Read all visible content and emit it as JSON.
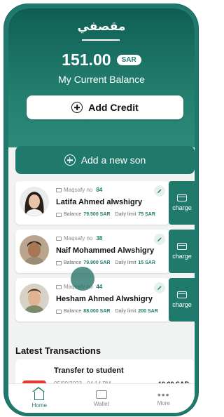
{
  "header": {
    "brand": "مقصفي",
    "balance": "151.00",
    "currency": "SAR",
    "balance_label": "My Current Balance",
    "add_credit_label": "Add Credit"
  },
  "add_son_label": "Add a new son",
  "sons": [
    {
      "maqsafy_label": "Maqsafy no",
      "maqsafy_no": "84",
      "name": "Latifa Ahmed alwshigry",
      "balance_label": "Balance",
      "balance": "79.500 SAR",
      "limit_label": "Daily limit",
      "limit": "75 SAR",
      "charge_label": "charge"
    },
    {
      "maqsafy_label": "Maqsafy no",
      "maqsafy_no": "38",
      "name": "Naif Mohammed Alwshigry",
      "balance_label": "Balance",
      "balance": "79.900 SAR",
      "limit_label": "Daily limit",
      "limit": "15 SAR",
      "charge_label": "charge"
    },
    {
      "maqsafy_label": "Maqsafy no",
      "maqsafy_no": "44",
      "name": "Hesham Ahmed Alwshigry",
      "balance_label": "Balance",
      "balance": "88.000 SAR",
      "limit_label": "Daily limit",
      "limit": "200 SAR",
      "charge_label": "charge"
    }
  ],
  "transactions": {
    "title": "Latest Transactions",
    "items": [
      {
        "title": "Transfer to student",
        "date": "05/09/2023 - 04:14 PM",
        "amount": "10.00 SAR"
      }
    ]
  },
  "nav": [
    {
      "label": "Home",
      "icon": "home-icon"
    },
    {
      "label": "Wallet",
      "icon": "wallet-icon"
    },
    {
      "label": "More",
      "icon": "more-icon"
    }
  ],
  "colors": {
    "primary": "#1f7a6b",
    "header_top": "#0e5f53",
    "background": "#f1f3f3",
    "accent_red": "#e53935"
  }
}
